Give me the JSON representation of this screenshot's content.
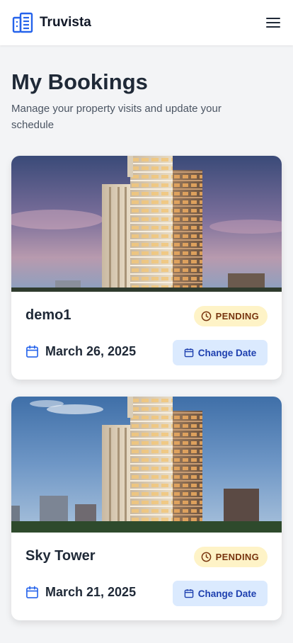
{
  "app": {
    "name": "Truvista",
    "logo_icon": "building-icon",
    "menu_icon": "hamburger-menu-icon"
  },
  "page": {
    "title": "My Bookings",
    "subtitle": "Manage your property visits and update your schedule"
  },
  "bookings": [
    {
      "property": "demo1",
      "status": "PENDING",
      "date": "March 26, 2025",
      "action_label": "Change Date",
      "image": "high-rise-residential-tower-dusk-photo"
    },
    {
      "property": "Sky Tower",
      "status": "PENDING",
      "date": "March 21, 2025",
      "action_label": "Change Date",
      "image": "high-rise-residential-tower-dusk-photo"
    }
  ],
  "colors": {
    "brand_blue": "#2563eb",
    "page_background": "#f3f4f6",
    "pending_badge_bg": "#fef3c7",
    "pending_badge_text": "#78350f",
    "action_button_bg": "#dbeafe",
    "action_button_text": "#1e40af"
  }
}
